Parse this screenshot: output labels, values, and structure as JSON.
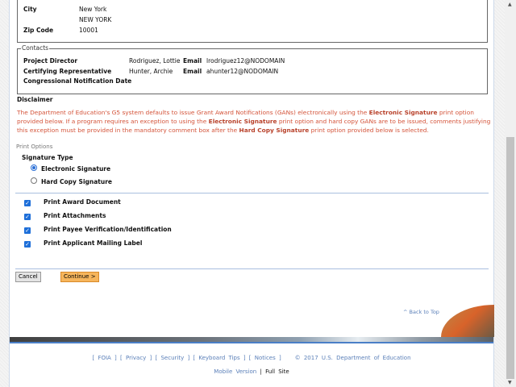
{
  "address": {
    "city_label": "City",
    "city": "New York",
    "city_upper": "NEW YORK",
    "zip_label": "Zip Code",
    "zip": "10001"
  },
  "contacts": {
    "legend": "Contacts",
    "email_label": "Email",
    "rows": [
      {
        "role": "Project Director",
        "name": "Rodriguez, Lottie",
        "email": "lrodriguez12@NODOMAIN"
      },
      {
        "role": "Certifying Representative",
        "name": "Hunter, Archie",
        "email": "ahunter12@NODOMAIN"
      },
      {
        "role": "Congressional Notification Date"
      }
    ]
  },
  "disclaimer": {
    "title": "Disclaimer",
    "p1": "The Department of Education's G5 system defaults to issue Grant Award Notifications (GANs) electronically using the ",
    "b1": "Electronic Signature",
    "p2": " print option provided below. If a program requires an exception to using the ",
    "b2": "Electronic Signature",
    "p3": " print option and hard copy GANs are to be issued, comments justifying this exception must be provided in the mandatory comment box after the ",
    "b3": "Hard Copy Signature",
    "p4": " print option provided below is selected."
  },
  "print_options": {
    "title": "Print Options",
    "signature_type": "Signature Type",
    "radios": [
      {
        "label": "Electronic Signature",
        "selected": true
      },
      {
        "label": "Hard Copy Signature",
        "selected": false
      }
    ],
    "checkboxes": [
      {
        "label": "Print Award Document",
        "checked": true
      },
      {
        "label": "Print Attachments",
        "checked": true
      },
      {
        "label": "Print Payee Verification/Identification",
        "checked": true
      },
      {
        "label": "Print Applicant Mailing Label",
        "checked": true
      }
    ]
  },
  "buttons": {
    "cancel": "Cancel",
    "continue": "Continue >"
  },
  "back_to_top": "^ Back to Top",
  "footer": {
    "links": [
      "FOIA",
      "Privacy",
      "Security",
      "Keyboard Tips",
      "Notices"
    ],
    "copyright": "© 2017 U.S. Department of Education",
    "mobile": "Mobile Version",
    "sep": "|",
    "full": "Full Site"
  },
  "colors": {
    "accent": "#d4543a",
    "continue_bg": "#f6b55c",
    "link": "#5a7fb8"
  }
}
